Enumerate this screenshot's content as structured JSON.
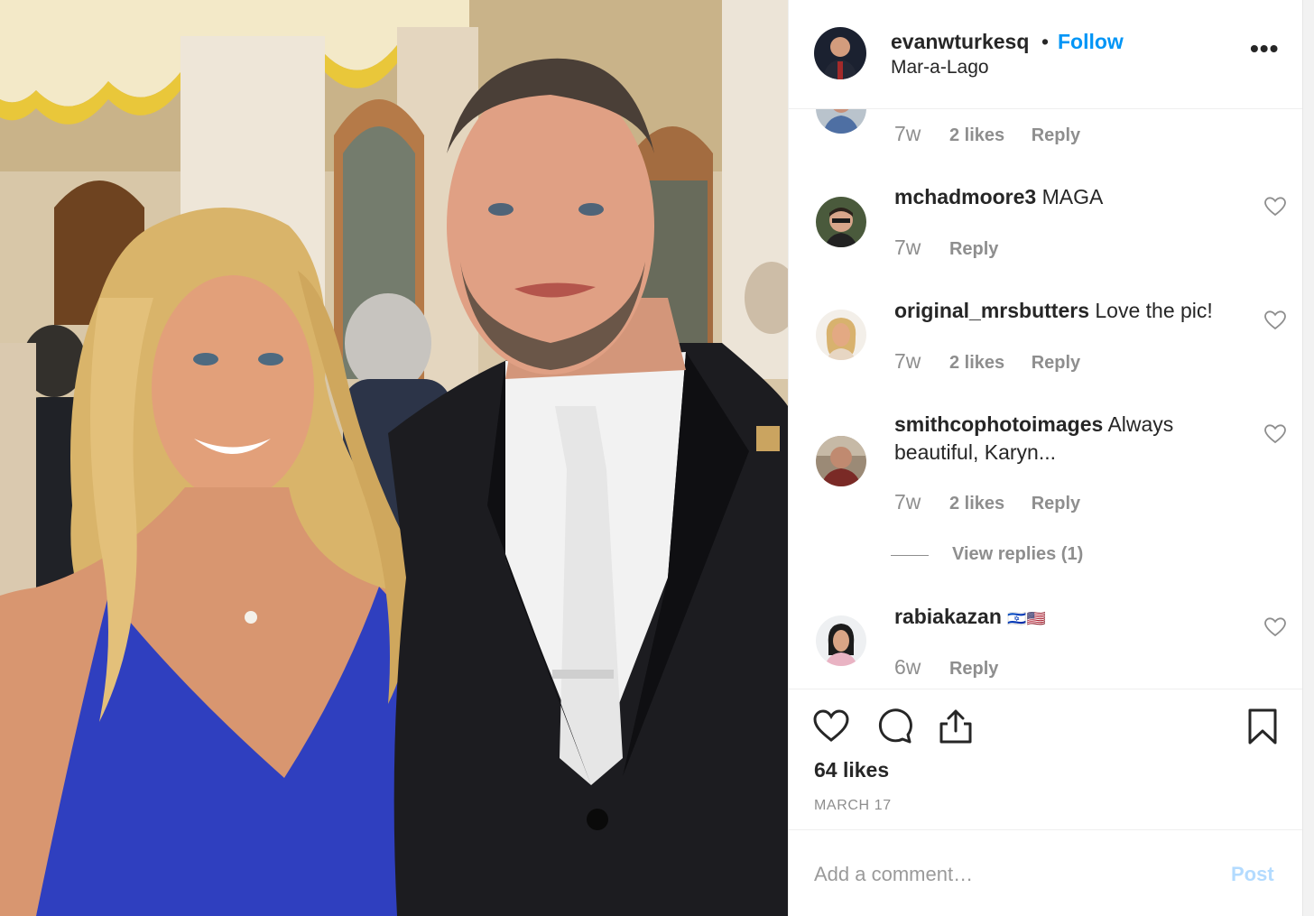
{
  "post": {
    "username": "evanwturkesq",
    "separator": "•",
    "follow_label": "Follow",
    "location": "Mar-a-Lago",
    "more_label": "•••",
    "likes_label": "64 likes",
    "date_label": "MARCH 17"
  },
  "comments": [
    {
      "username": "",
      "text": "",
      "age": "7w",
      "likes": "2 likes",
      "reply": "Reply"
    },
    {
      "username": "mchadmoore3",
      "text": "MAGA",
      "age": "7w",
      "likes": "",
      "reply": "Reply"
    },
    {
      "username": "original_mrsbutters",
      "text": "Love the pic!",
      "age": "7w",
      "likes": "2 likes",
      "reply": "Reply"
    },
    {
      "username": "smithcophotoimages",
      "text": "Always beautiful, Karyn...",
      "age": "7w",
      "likes": "2 likes",
      "reply": "Reply"
    },
    {
      "username": "rabiakazan",
      "text": "🇮🇱🇺🇸",
      "age": "6w",
      "likes": "",
      "reply": "Reply"
    }
  ],
  "view_replies_label": "View replies (1)",
  "add_comment": {
    "placeholder": "Add a comment…",
    "post_label": "Post"
  },
  "icons": {
    "like": "heart-icon",
    "comment": "comment-icon",
    "share": "share-icon",
    "save": "bookmark-icon",
    "more": "more-options-icon"
  },
  "colors": {
    "follow": "#0095f6",
    "post_disabled": "#b3dbff",
    "muted": "#8e8e8e",
    "text": "#262626"
  }
}
